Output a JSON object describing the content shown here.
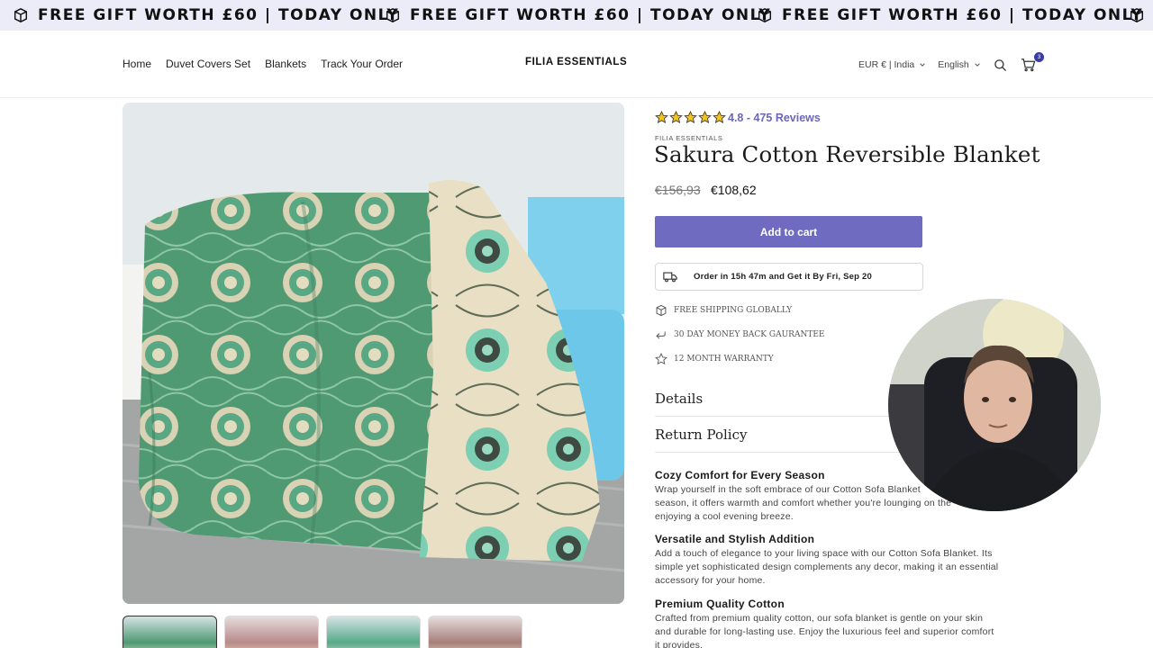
{
  "announcement": {
    "text": "FREE GIFT WORTH £60 | TODAY ONLY",
    "icon": "box-icon"
  },
  "header": {
    "nav": [
      "Home",
      "Duvet Covers Set",
      "Blankets",
      "Track Your Order"
    ],
    "logo": "FILIA ESSENTIALS",
    "currency": "EUR € | India",
    "language": "English",
    "cart_count": "3"
  },
  "product": {
    "rating_text": "4.8 - 475 Reviews",
    "stars": 5,
    "vendor": "FILIA ESSENTIALS",
    "title": "Sakura Cotton Reversible Blanket",
    "price_old": "€156,93",
    "price_new": "€108,62",
    "add_to_cart": "Add to cart",
    "delivery": "Order in 15h 47m and Get it By Fri, Sep 20",
    "perks": [
      "FREE SHIPPING GLOBALLY",
      "30 DAY MONEY BACK GAURANTEE",
      "12 MONTH WARRANTY"
    ],
    "accordions": [
      "Details",
      "Return Policy"
    ],
    "description": [
      {
        "heading": "Cozy Comfort for Every Season",
        "lines": [
          "Wrap yourself in the soft embrace of our Cotton Sofa Blanket",
          "season, it offers warmth and comfort whether you're lounging on the",
          "enjoying a cool evening breeze."
        ]
      },
      {
        "heading": "Versatile and Stylish Addition",
        "lines": [
          "Add a touch of elegance to your living space with our Cotton Sofa Blanket. Its",
          "simple yet sophisticated design complements any decor, making it an essential",
          "accessory for your home."
        ]
      },
      {
        "heading": "Premium Quality Cotton",
        "lines": [
          "Crafted from premium quality cotton, our sofa blanket is gentle on your skin",
          "and durable for long-lasting use. Enjoy the luxurious feel and superior comfort",
          "it provides."
        ]
      }
    ]
  },
  "colors": {
    "accent": "#6f6bc0",
    "rating": "#6b67b8",
    "announcement_bg": "#ecebf8",
    "star": "#f2c21b"
  }
}
